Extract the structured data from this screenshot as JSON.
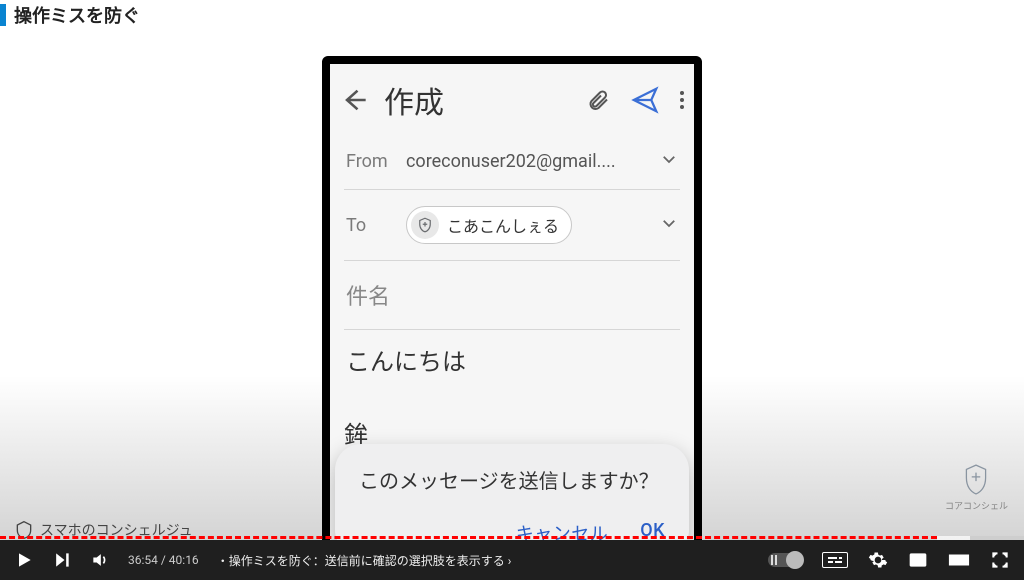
{
  "page": {
    "title": "操作ミスを防ぐ"
  },
  "phone": {
    "compose_title": "作成",
    "from_label": "From",
    "from_value": "coreconuser202@gmail....",
    "to_label": "To",
    "to_chip_name": "こあこんしぇる",
    "subject_placeholder": "件名",
    "body_text": "こんにちは",
    "clipped_char": "鉾"
  },
  "dialog": {
    "message": "このメッセージを送信しますか？",
    "cancel": "キャンセル",
    "ok": "OK"
  },
  "watermark": {
    "right_text": "コアコンシェル",
    "left_text": "スマホのコンシェルジュ"
  },
  "player": {
    "current_time": "36:54",
    "total_time": "40:16",
    "separator": " / ",
    "chapter_bullet": "・",
    "chapter_title": "操作ミスを防ぐ：送信前に確認の選択肢を表示する",
    "chapter_caret": "›"
  }
}
